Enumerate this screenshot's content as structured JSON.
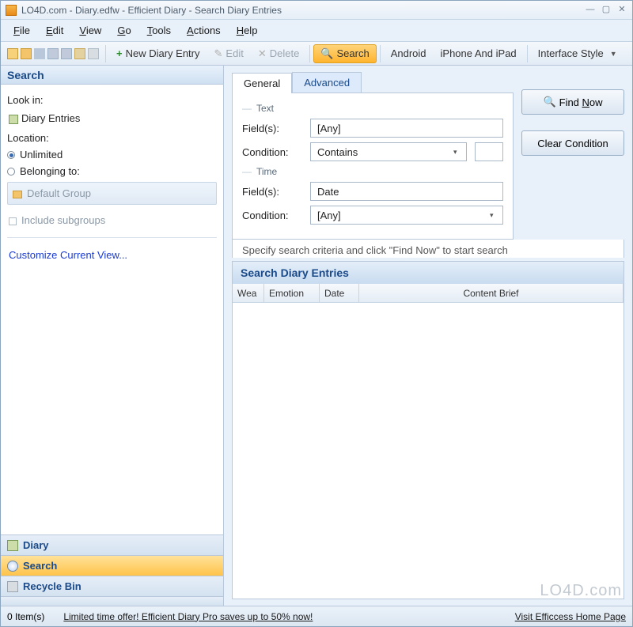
{
  "title": "LO4D.com - Diary.edfw - Efficient Diary - Search Diary Entries",
  "menus": {
    "file": "File",
    "edit": "Edit",
    "view": "View",
    "go": "Go",
    "tools": "Tools",
    "actions": "Actions",
    "help": "Help"
  },
  "toolbar": {
    "new": "New Diary Entry",
    "edit": "Edit",
    "delete": "Delete",
    "search": "Search",
    "android": "Android",
    "iphone": "iPhone And iPad",
    "interface": "Interface Style"
  },
  "left": {
    "header": "Search",
    "look_in": "Look in:",
    "diary_entries": "Diary Entries",
    "location": "Location:",
    "unlimited": "Unlimited",
    "belonging": "Belonging to:",
    "default_group": "Default Group",
    "include_sub": "Include subgroups",
    "customize": "Customize Current View..."
  },
  "nav": {
    "diary": "Diary",
    "search": "Search",
    "recycle": "Recycle Bin"
  },
  "tabs": {
    "general": "General",
    "advanced": "Advanced"
  },
  "criteria": {
    "text": "Text",
    "time": "Time",
    "fields": "Field(s):",
    "condition": "Condition:",
    "text_fields_val": "[Any]",
    "text_cond_val": "Contains",
    "time_fields_val": "Date",
    "time_cond_val": "[Any]"
  },
  "buttons": {
    "find": "Find Now",
    "clear": "Clear Condition"
  },
  "instr": "Specify search criteria and click \"Find Now\" to start search",
  "results": {
    "header": "Search Diary Entries",
    "cols": {
      "wea": "Wea",
      "emo": "Emotion",
      "date": "Date",
      "content": "Content Brief"
    }
  },
  "status": {
    "items": "0 Item(s)",
    "offer": "Limited time offer! Efficient Diary Pro saves up to 50% now!",
    "visit": "Visit Efficcess Home Page"
  },
  "watermark": "LO4D.com"
}
